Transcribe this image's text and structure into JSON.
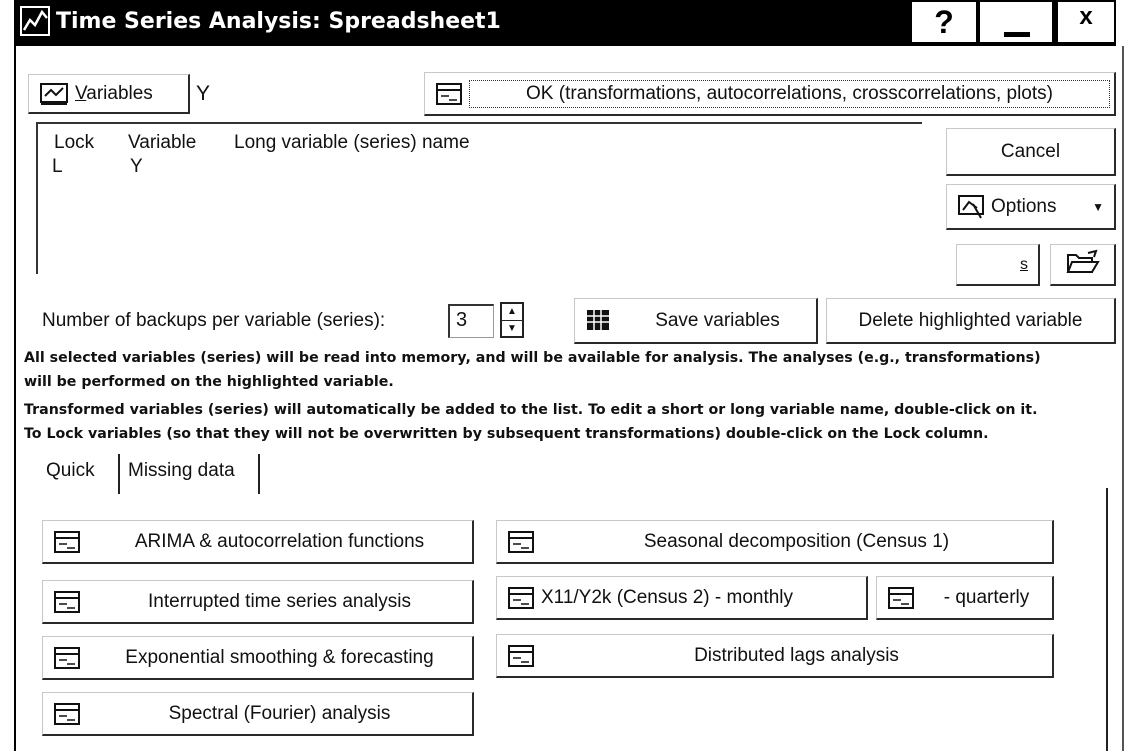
{
  "window": {
    "title": "Time Series Analysis: Spreadsheet1",
    "help_label": "?",
    "close_label": "x"
  },
  "variables": {
    "button_label": "Variables",
    "button_underline": "V",
    "selected": "Y"
  },
  "ok_button": {
    "label": "OK (transformations, autocorrelations, crosscorrelations, plots)"
  },
  "variable_list": {
    "columns": [
      "Lock",
      "Variable",
      "Long variable (series) name"
    ],
    "rows": [
      {
        "lock": "L",
        "variable": "Y",
        "long_name": ""
      }
    ]
  },
  "side_buttons": {
    "cancel": "Cancel",
    "options": "Options",
    "s_label": "s"
  },
  "backups": {
    "label": "Number of backups per variable (series):",
    "value": "3"
  },
  "save_variables": "Save variables",
  "delete_highlighted": "Delete highlighted variable",
  "info": {
    "line1": "All selected variables (series) will be read into memory, and will be available for analysis. The analyses (e.g., transformations)",
    "line2": "will be performed on the highlighted variable.",
    "line3": "Transformed variables (series) will automatically be added to the list. To edit a short or long variable name, double-click on it.",
    "line4": "To Lock variables (so that they will not be overwritten by subsequent transformations) double-click on the Lock column."
  },
  "tabs": [
    "Quick",
    "Missing data"
  ],
  "quick": {
    "arima": "ARIMA & autocorrelation functions",
    "interrupted": "Interrupted time series analysis",
    "exponential": "Exponential smoothing & forecasting",
    "spectral": "Spectral (Fourier) analysis",
    "seasonal": "Seasonal decomposition (Census 1)",
    "x11_monthly": "X11/Y2k (Census 2) - monthly",
    "quarterly": "- quarterly",
    "distributed": "Distributed lags analysis"
  },
  "colors": {
    "titlebar": "#000000",
    "background": "#ffffff"
  }
}
